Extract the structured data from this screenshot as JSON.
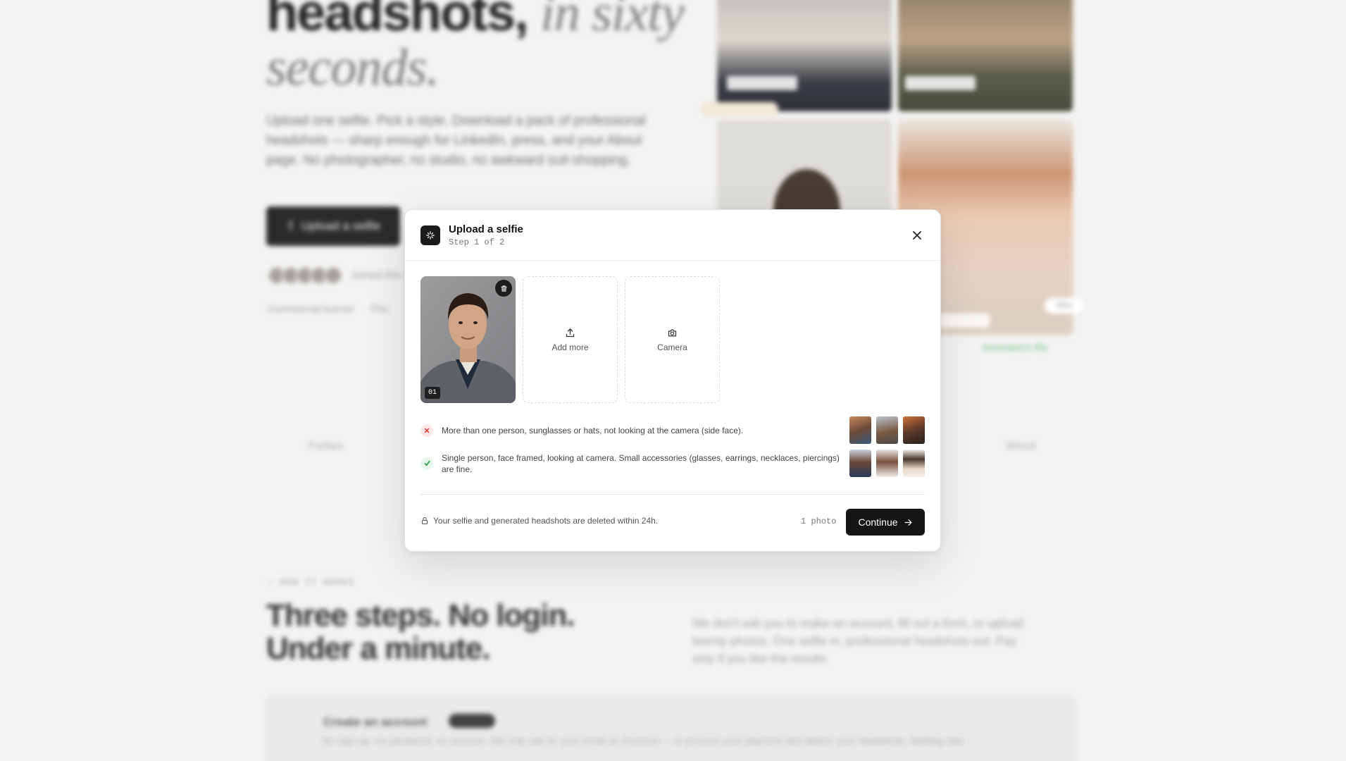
{
  "background": {
    "hero_title_bold": "headshots,",
    "hero_title_italic_1": "in sixty",
    "hero_title_italic_2": "seconds.",
    "hero_description": "Upload one selfie. Pick a style. Download a pack of professional headshots — sharp enough for LinkedIn, press, and your About page. No photographer, no studio, no awkward suit-shopping.",
    "hero_button": "Upload a selfie",
    "joined_text": "Joined this w",
    "meta_license": "Commercial license",
    "meta_photo": "Pho",
    "brand_left": "Forbes",
    "brand_right": "Wired",
    "how_label": "— HOW IT WORKS",
    "how_title": "Three steps. No login. Under a minute.",
    "how_description": "We don't ask you to make an account, fill out a form, or upload twenty photos. One selfie in, professional headshots out. Pay only if you like the results.",
    "step_title": "Create an account",
    "step_description": "No sign-up, no password, no account. We only ask for your email at checkout — to process your payment and deliver your headshots. Nothing else.",
    "badge_text": "Generated in 45s",
    "badge_percent": "95%"
  },
  "modal": {
    "title": "Upload a selfie",
    "subtitle": "Step 1 of 2",
    "selfie_index": "01",
    "add_more_label": "Add more",
    "camera_label": "Camera",
    "rule_bad": "More than one person, sunglasses or hats, not looking at the camera (side face).",
    "rule_good": "Single person, face framed, looking at camera. Small accessories (glasses, earrings, necklaces, piercings) are fine.",
    "privacy_note": "Your selfie and generated headshots are deleted within 24h.",
    "photo_count": "1 photo",
    "continue_label": "Continue",
    "colors": {
      "bad": "#d93a3a",
      "good": "#2f9e4f",
      "primary": "#151515"
    },
    "icons": [
      "sparkle-icon",
      "close-icon",
      "trash-icon",
      "upload-icon",
      "camera-icon",
      "x-icon",
      "check-icon",
      "lock-icon",
      "arrow-right-icon"
    ]
  }
}
